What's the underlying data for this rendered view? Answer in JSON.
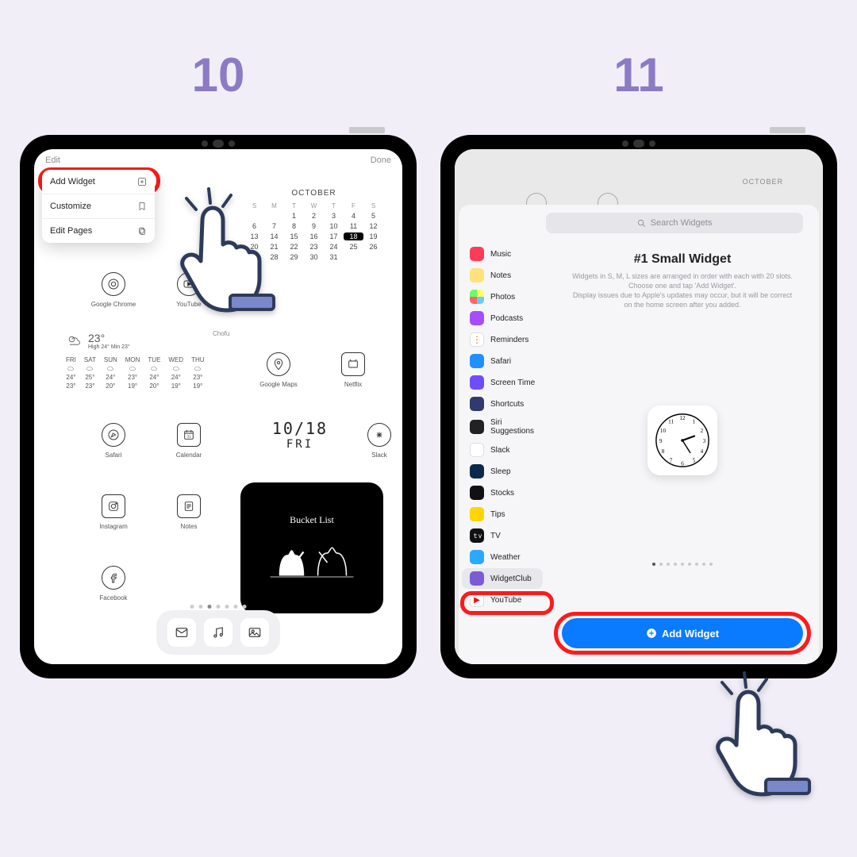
{
  "steps": {
    "s10": "10",
    "s11": "11"
  },
  "left": {
    "topbar": {
      "edit": "Edit",
      "done": "Done"
    },
    "menu": {
      "add": "Add Widget",
      "customize": "Customize",
      "pages": "Edit Pages"
    },
    "calendar": {
      "title": "OCTOBER",
      "dow": [
        "S",
        "M",
        "T",
        "W",
        "T",
        "F",
        "S"
      ],
      "days": [
        "",
        "",
        "1",
        "2",
        "3",
        "4",
        "5",
        "6",
        "7",
        "8",
        "9",
        "10",
        "11",
        "12",
        "13",
        "14",
        "15",
        "16",
        "17",
        "18",
        "19",
        "20",
        "21",
        "22",
        "23",
        "24",
        "25",
        "26",
        "27",
        "28",
        "29",
        "30",
        "31",
        "",
        ""
      ],
      "today": "18"
    },
    "apps": {
      "chrome": "Google Chrome",
      "youtube": "YouTube",
      "maps": "Google Maps",
      "netflix": "Netflix",
      "safari": "Safari",
      "calendarApp": "Calendar",
      "slack": "Slack",
      "instagram": "Instagram",
      "notes": "Notes",
      "facebook": "Facebook"
    },
    "weather": {
      "temp": "23°",
      "sub": "High 24° Min 23°",
      "label": "Chofu",
      "cells": [
        {
          "d": "FRI",
          "h": "24°",
          "l": "23°"
        },
        {
          "d": "SAT",
          "h": "25°",
          "l": "23°"
        },
        {
          "d": "SUN",
          "h": "24°",
          "l": "20°"
        },
        {
          "d": "MON",
          "h": "23°",
          "l": "19°"
        },
        {
          "d": "TUE",
          "h": "24°",
          "l": "20°"
        },
        {
          "d": "WED",
          "h": "24°",
          "l": "19°"
        },
        {
          "d": "THU",
          "h": "23°",
          "l": "19°"
        }
      ]
    },
    "date": {
      "d": "10/18",
      "w": "FRI"
    },
    "bucket": "Bucket List"
  },
  "right": {
    "oct": "OCTOBER",
    "search": "Search Widgets",
    "title": "#1 Small Widget",
    "desc1": "Widgets in S, M, L sizes are arranged in order with each with 20 slots. Choose one and tap 'Add Widget'.",
    "desc2": "Display issues due to Apple's updates may occur, but it will be correct on the home screen after you added.",
    "addBtn": "Add Widget",
    "apps": [
      {
        "n": "Music",
        "c": "#ff3b57"
      },
      {
        "n": "Notes",
        "c": "#ffe27a"
      },
      {
        "n": "Photos",
        "c": "#fff",
        "multi": true
      },
      {
        "n": "Podcasts",
        "c": "#a64dff"
      },
      {
        "n": "Reminders",
        "c": "#fff",
        "dots": true
      },
      {
        "n": "Safari",
        "c": "#1e90ff"
      },
      {
        "n": "Screen Time",
        "c": "#6e4dff"
      },
      {
        "n": "Shortcuts",
        "c": "#303a6e"
      },
      {
        "n": "Siri Suggestions",
        "c": "#222"
      },
      {
        "n": "Slack",
        "c": "#fff",
        "slack": true
      },
      {
        "n": "Sleep",
        "c": "#0a2a4a"
      },
      {
        "n": "Stocks",
        "c": "#111"
      },
      {
        "n": "Tips",
        "c": "#ffd400"
      },
      {
        "n": "TV",
        "c": "#111",
        "tv": true
      },
      {
        "n": "Weather",
        "c": "#2aa9ff"
      },
      {
        "n": "WidgetClub",
        "c": "#7b5bd6",
        "sel": true
      },
      {
        "n": "YouTube",
        "c": "#fff",
        "yt": true
      }
    ]
  }
}
